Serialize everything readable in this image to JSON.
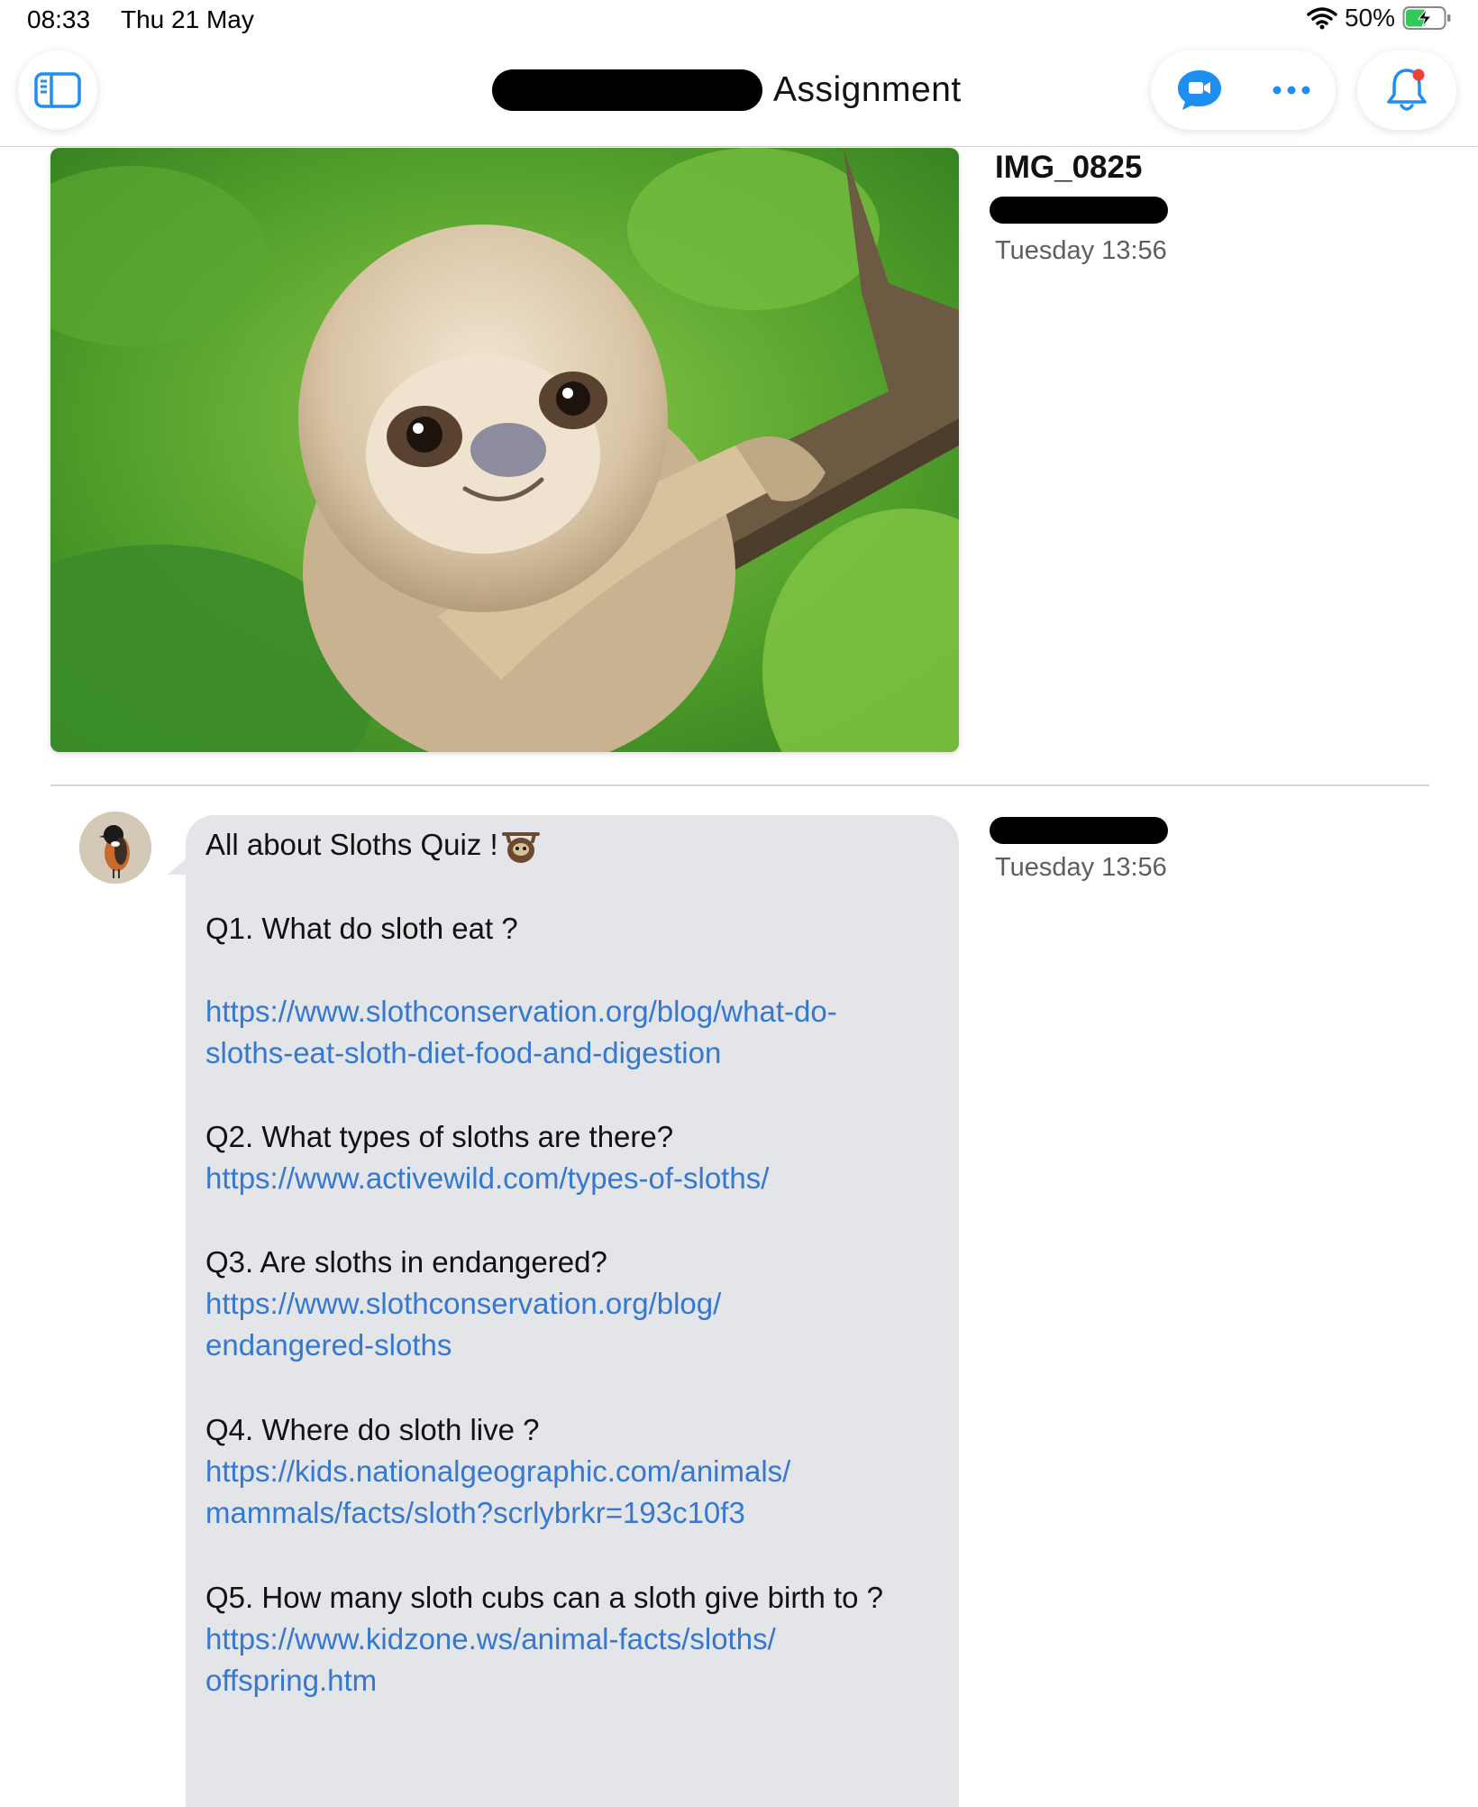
{
  "status_bar": {
    "time": "08:33",
    "date": "Thu 21 May",
    "battery": "50%"
  },
  "nav": {
    "title": "Assignment",
    "icons": [
      "sidebar-toggle-icon",
      "video-chat-icon",
      "more-icon",
      "bell-icon"
    ],
    "accent": "#1f8ef1"
  },
  "attachment": {
    "file_name": "IMG_0825",
    "timestamp": "Tuesday 13:56"
  },
  "message": {
    "timestamp": "Tuesday 13:56",
    "title": "All about Sloths Quiz !",
    "questions": [
      {
        "q": "Q1. What do sloth eat ?",
        "link_lines": [
          "https://www.slothconservation.org/blog/what-do-",
          "sloths-eat-sloth-diet-food-and-digestion"
        ]
      },
      {
        "q": "Q2. What types of sloths are there?",
        "link_lines": [
          "https://www.activewild.com/types-of-sloths/"
        ]
      },
      {
        "q": "Q3. Are sloths in endangered?",
        "link_lines": [
          "https://www.slothconservation.org/blog/",
          "endangered-sloths"
        ]
      },
      {
        "q": "Q4. Where do sloth live ?",
        "link_lines": [
          "https://kids.nationalgeographic.com/animals/",
          "mammals/facts/sloth?scrlybrkr=193c10f3"
        ]
      },
      {
        "q": "Q5. How many sloth cubs can a sloth give birth to ?",
        "link_lines": [
          "https://www.kidzone.ws/animal-facts/sloths/",
          "offspring.htm"
        ]
      }
    ],
    "link_color": "#3478d0",
    "bubble_color": "#e4e5e9"
  }
}
